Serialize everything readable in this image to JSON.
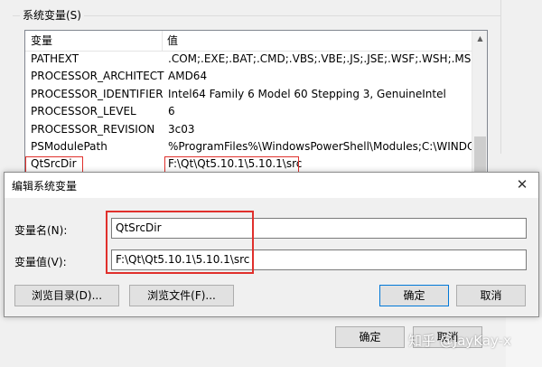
{
  "background_dialog": {
    "group_label": "系统变量(S)",
    "table": {
      "headers": {
        "name": "变量",
        "value": "值"
      },
      "rows": [
        {
          "name": "PATHEXT",
          "value": ".COM;.EXE;.BAT;.CMD;.VBS;.VBE;.JS;.JSE;.WSF;.WSH;.MSC"
        },
        {
          "name": "PROCESSOR_ARCHITECT",
          "value": "AMD64"
        },
        {
          "name": "PROCESSOR_IDENTIFIER",
          "value": "Intel64 Family 6 Model 60 Stepping 3, GenuineIntel"
        },
        {
          "name": "PROCESSOR_LEVEL",
          "value": "6"
        },
        {
          "name": "PROCESSOR_REVISION",
          "value": "3c03"
        },
        {
          "name": "PSModulePath",
          "value": "%ProgramFiles%\\WindowsPowerShell\\Modules;C:\\WINDOW..."
        },
        {
          "name": "QtSrcDir",
          "value": "F:\\Qt\\Qt5.10.1\\5.10.1\\src"
        }
      ]
    },
    "buttons": {
      "ok": "确定",
      "cancel": "取消"
    }
  },
  "edit_dialog": {
    "title": "编辑系统变量",
    "close_glyph": "✕",
    "name_label": "变量名(N):",
    "name_value": "QtSrcDir",
    "value_label": "变量值(V):",
    "value_value": "F:\\Qt\\Qt5.10.1\\5.10.1\\src",
    "buttons": {
      "browse_dir": "浏览目录(D)...",
      "browse_file": "浏览文件(F)...",
      "ok": "确定",
      "cancel": "取消"
    }
  },
  "watermark": "知乎 @JayKay-x",
  "colors": {
    "highlight_red": "#e0302c",
    "default_button_border": "#0078d7"
  },
  "icons": {
    "scroll_up": "chevron-up-icon",
    "close": "close-icon"
  }
}
